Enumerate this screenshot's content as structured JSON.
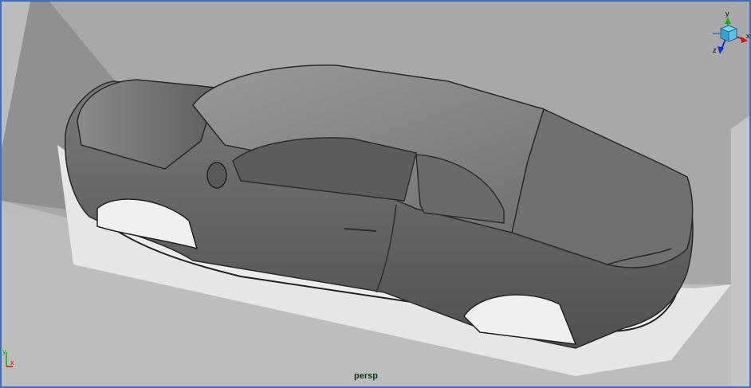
{
  "viewport": {
    "camera_name": "persp",
    "view_cube": {
      "y_label": "y",
      "x_label": "x",
      "z_label": "z"
    },
    "axis_indicator": {
      "x_label": "x",
      "y_label": "y"
    },
    "colors": {
      "frame": "#3b6fbf",
      "background": "#bdbdbd",
      "camera_label": "#0a3a18",
      "axis_x": "#d01010",
      "axis_y": "#10b010",
      "axis_z": "#1030d0"
    }
  },
  "icons": [
    "view-cube-icon",
    "axis-indicator-icon"
  ]
}
